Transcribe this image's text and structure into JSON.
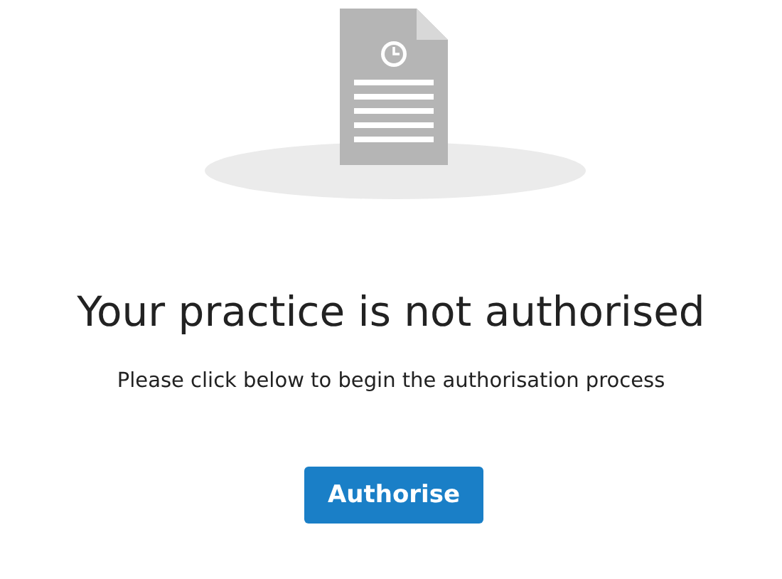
{
  "heading": "Your practice is not authorised",
  "message": "Please click below to begin the authorisation process",
  "button": {
    "label": "Authorise"
  }
}
